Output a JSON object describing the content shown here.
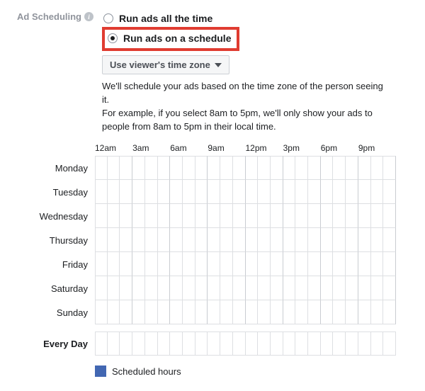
{
  "section_label": "Ad Scheduling",
  "options": {
    "all_time": "Run ads all the time",
    "schedule": "Run ads on a schedule"
  },
  "selected_option": "schedule",
  "timezone_dropdown": "Use viewer's time zone",
  "explain_1": "We'll schedule your ads based on the time zone of the person seeing it.",
  "explain_2": "For example, if you select 8am to 5pm, we'll only show your ads to people from 8am to 5pm in their local time.",
  "hours": [
    "12am",
    "3am",
    "6am",
    "9am",
    "12pm",
    "3pm",
    "6pm",
    "9pm"
  ],
  "days": [
    "Monday",
    "Tuesday",
    "Wednesday",
    "Thursday",
    "Friday",
    "Saturday",
    "Sunday"
  ],
  "every_day": "Every Day",
  "legend_label": "Scheduled hours",
  "legend_color": "#4267b2"
}
